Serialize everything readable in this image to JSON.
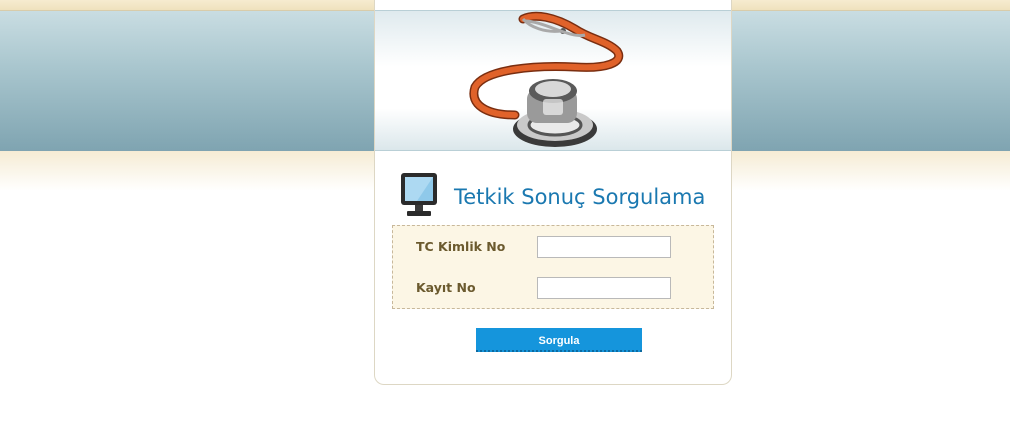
{
  "page": {
    "title": "Tetkik Sonuç Sorgulama"
  },
  "header": {
    "banner_image": "stethoscope-illustration"
  },
  "form": {
    "tc_label": "TC Kimlik No",
    "tc_value": "",
    "kayit_label": "Kayıt No",
    "kayit_value": "",
    "submit_label": "Sorgula"
  },
  "colors": {
    "header_band": "#93b5bf",
    "title": "#1a78b0",
    "label": "#6b5a2e",
    "form_background": "#fcf6e5",
    "button": "#1595dc"
  }
}
